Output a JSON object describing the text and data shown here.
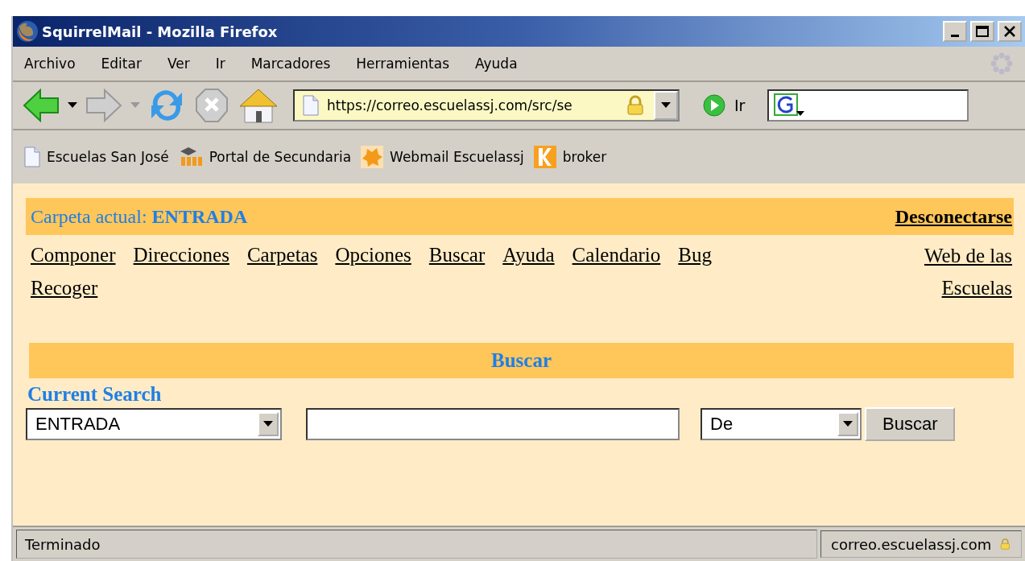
{
  "window": {
    "title": "SquirrelMail - Mozilla Firefox"
  },
  "menu": [
    "Archivo",
    "Editar",
    "Ver",
    "Ir",
    "Marcadores",
    "Herramientas",
    "Ayuda"
  ],
  "toolbar": {
    "address": "https://correo.escuelassj.com/src/se",
    "go_label": "Ir"
  },
  "bookmarks": [
    {
      "label": "Escuelas San José",
      "kind": "page"
    },
    {
      "label": "Portal de Secundaria",
      "kind": "moodle"
    },
    {
      "label": "Webmail Escuelassj",
      "kind": "webmail"
    },
    {
      "label": "broker",
      "kind": "broker"
    }
  ],
  "page": {
    "folder_label": "Carpeta actual:",
    "folder": "ENTRADA",
    "logout": "Desconectarse",
    "links": [
      "Componer",
      "Direcciones",
      "Carpetas",
      "Opciones",
      "Buscar",
      "Ayuda",
      "Calendario",
      "Bug",
      "Recoger"
    ],
    "right_link": "Web de las Escuelas",
    "section_title": "Buscar",
    "subsection": "Current Search",
    "search": {
      "mailbox": "ENTRADA",
      "field": "De",
      "button": "Buscar"
    }
  },
  "status_bar": {
    "text": "Terminado",
    "host": "correo.escuelassj.com"
  }
}
